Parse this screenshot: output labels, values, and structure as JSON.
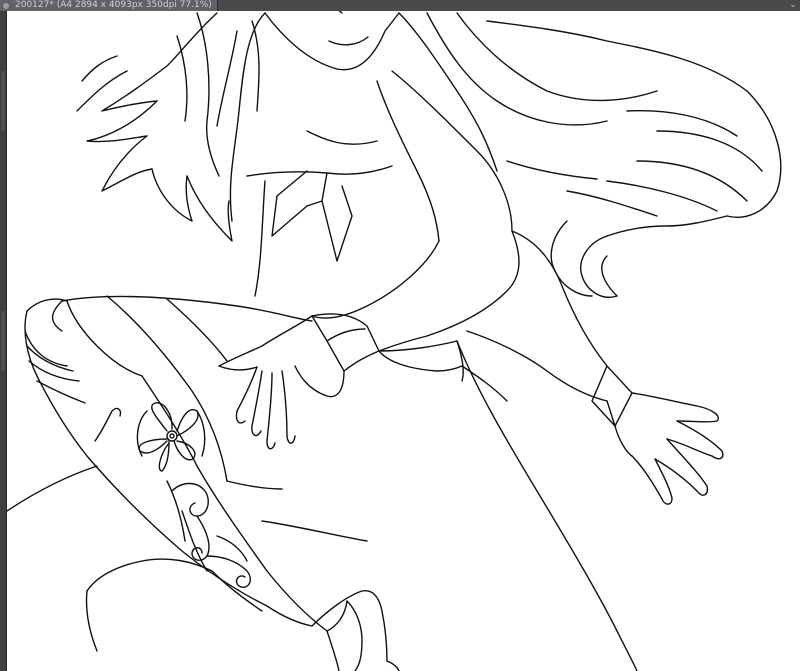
{
  "window": {
    "document_tab_title": "200127* (A4 2894 x 4093px 350dpi 77.1%)",
    "tab_icon": "document-icon",
    "close_icon": "chevron-down-icon"
  },
  "canvas": {
    "content": "line-art-illustration",
    "background_color": "#ffffff",
    "line_color": "#111111"
  },
  "colors": {
    "ui_dark": "#3a3a3c",
    "tab_active": "#626266",
    "tab_text": "#cfcfd3"
  }
}
